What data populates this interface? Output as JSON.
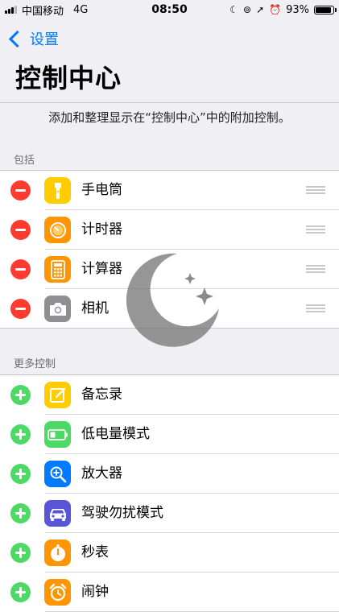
{
  "status_bar": {
    "carrier": "中国移动",
    "network": "4G",
    "time": "08:50",
    "battery_percent_text": "93%",
    "battery_level": 0.93
  },
  "nav": {
    "back_label": "设置",
    "title": "控制中心"
  },
  "description": "添加和整理显示在“控制中心”中的附加控制。",
  "included": {
    "header": "包括",
    "items": [
      {
        "label": "手电筒",
        "icon": "flashlight-icon",
        "color": "#ffcc00"
      },
      {
        "label": "计时器",
        "icon": "timer-icon",
        "color": "#ff9500"
      },
      {
        "label": "计算器",
        "icon": "calculator-icon",
        "color": "#ff9500"
      },
      {
        "label": "相机",
        "icon": "camera-icon",
        "color": "#8e8e93"
      }
    ]
  },
  "more": {
    "header": "更多控制",
    "items": [
      {
        "label": "备忘录",
        "icon": "notes-icon",
        "color": "#ffcc00"
      },
      {
        "label": "低电量模式",
        "icon": "low-power-battery-icon",
        "color": "#4cd964"
      },
      {
        "label": "放大器",
        "icon": "magnifier-icon",
        "color": "#007aff"
      },
      {
        "label": "驾驶勿扰模式",
        "icon": "car-icon",
        "color": "#5856d6"
      },
      {
        "label": "秒表",
        "icon": "stopwatch-icon",
        "color": "#ff9500"
      },
      {
        "label": "闹钟",
        "icon": "alarm-icon",
        "color": "#ff9500"
      }
    ]
  },
  "colors": {
    "accent": "#007aff",
    "remove": "#ff3b30",
    "add": "#4cd964",
    "background": "#efeff4"
  }
}
